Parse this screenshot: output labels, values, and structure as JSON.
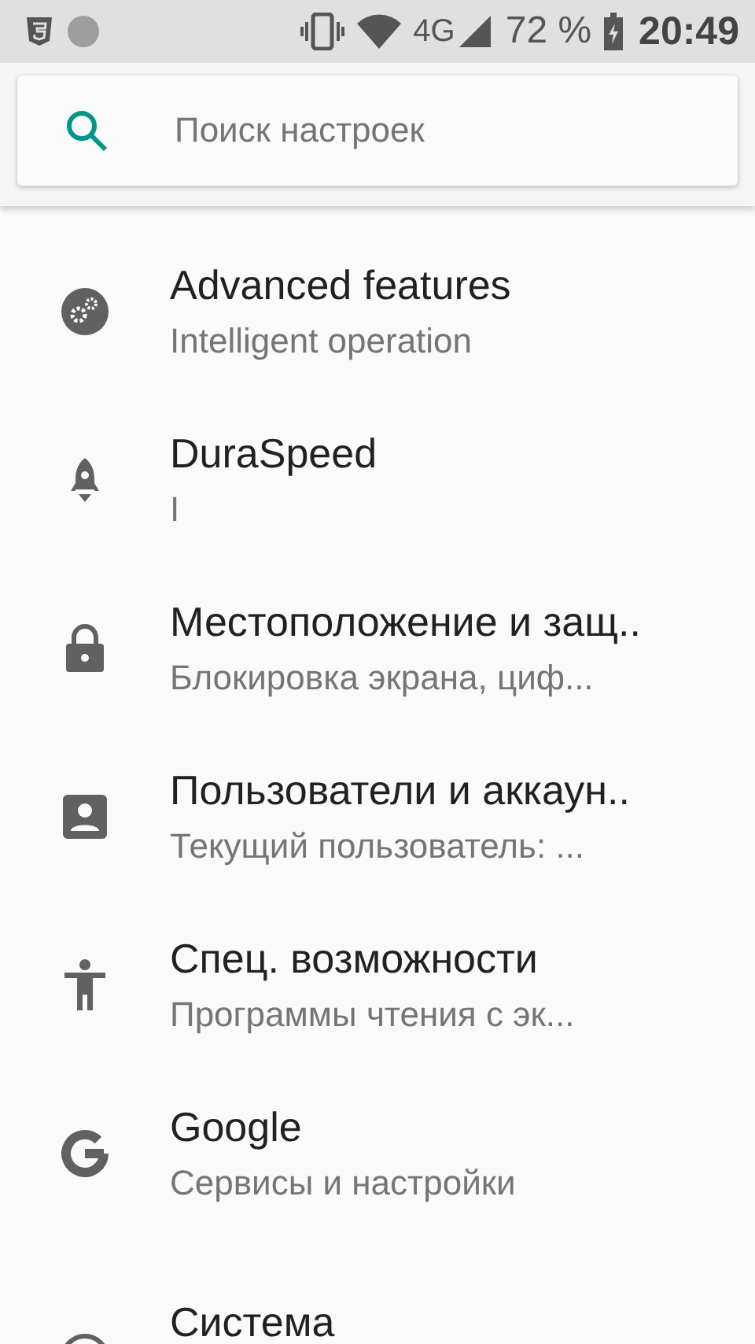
{
  "status_bar": {
    "network": "4G",
    "battery": "72 %",
    "time": "20:49"
  },
  "search": {
    "placeholder": "Поиск настроек"
  },
  "items": [
    {
      "kind": "gears",
      "title": "Advanced features",
      "subtitle": "Intelligent operation"
    },
    {
      "kind": "rocket",
      "title": "DuraSpeed",
      "subtitle": "I"
    },
    {
      "kind": "lock",
      "title": "Местоположение и защ..",
      "subtitle": "Блокировка экрана, циф..."
    },
    {
      "kind": "account",
      "title": "Пользователи и аккаун..",
      "subtitle": "Текущий пользователь: ..."
    },
    {
      "kind": "accessibility",
      "title": "Спец. возможности",
      "subtitle": "Программы чтения с эк..."
    },
    {
      "kind": "google",
      "title": "Google",
      "subtitle": "Сервисы и настройки"
    },
    {
      "kind": "system",
      "title": "Система"
    }
  ]
}
